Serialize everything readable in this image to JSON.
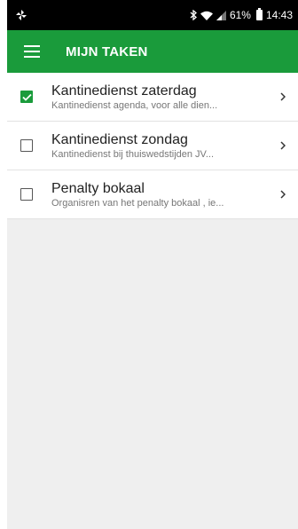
{
  "status_bar": {
    "battery_text": "61%",
    "time": "14:43",
    "icons": [
      "pinwheel-icon",
      "bluetooth-icon",
      "wifi-icon",
      "signal-icon",
      "battery-icon"
    ]
  },
  "app_bar": {
    "title": "MIJN TAKEN",
    "color": "#1a9b3b"
  },
  "tasks": [
    {
      "title": "Kantinedienst zaterdag",
      "description": "Kantinedienst agenda, voor alle dien...",
      "checked": true
    },
    {
      "title": "Kantinedienst zondag",
      "description": "Kantinedienst bij thuiswedstijden JV...",
      "checked": false
    },
    {
      "title": "Penalty bokaal",
      "description": "Organisren van het penalty bokaal , ie...",
      "checked": false
    }
  ]
}
